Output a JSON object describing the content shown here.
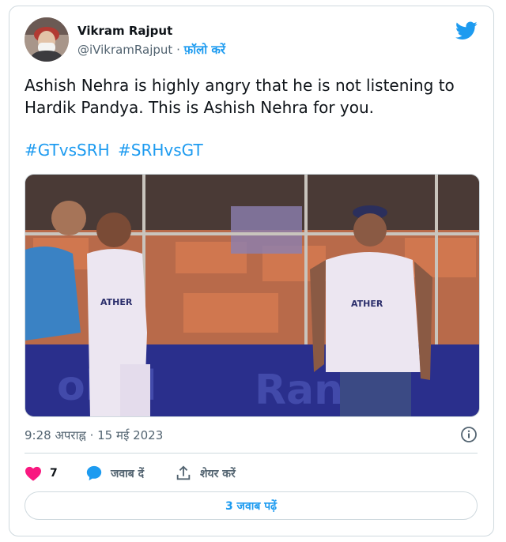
{
  "author": {
    "name": "Vikram Rajput",
    "handle": "@iVikramRajput",
    "separator": "·",
    "follow_label": "फ़ॉलो करें"
  },
  "tweet": {
    "text_line1": "Ashish Nehra is highly angry that he is not listening to",
    "text_line2": "Hardik Pandya. This is Ashish Nehra for you.",
    "hashtags": [
      "#GTvsSRH",
      "#SRHvsGT"
    ]
  },
  "media": {
    "jersey_text_left": "ATHER",
    "jersey_text_right": "ATHER"
  },
  "meta": {
    "time": "9:28 अपराह्न",
    "separator": "·",
    "date": "15 मई 2023"
  },
  "actions": {
    "like_count": "7",
    "reply_label": "जवाब दें",
    "share_label": "शेयर करें"
  },
  "replies_button": {
    "label": "3 जवाब पढ़ें"
  },
  "colors": {
    "accent": "#1d9bf0",
    "like": "#f91880",
    "text": "#0f1419",
    "muted": "#536471",
    "border": "#cfd9de"
  },
  "icons": [
    "twitter-bird-icon",
    "info-icon",
    "heart-icon",
    "reply-bubble-icon",
    "share-icon"
  ]
}
